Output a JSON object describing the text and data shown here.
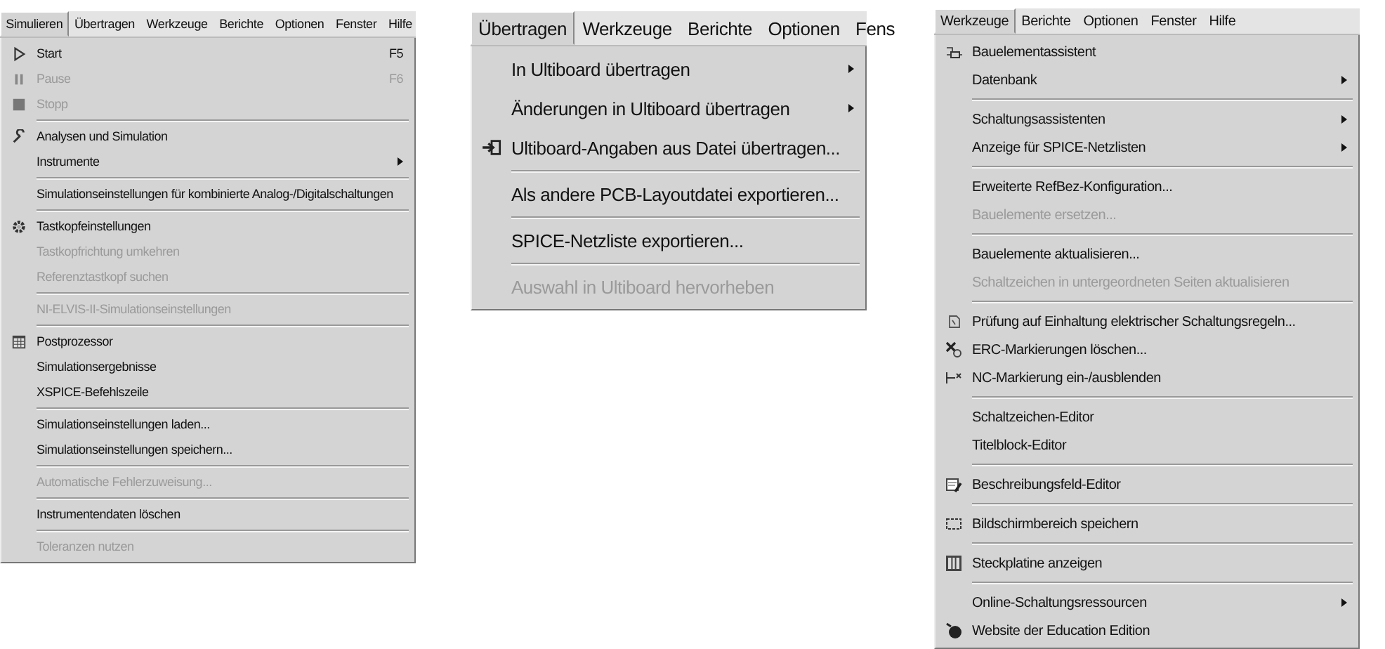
{
  "menus": [
    {
      "menubar": [
        {
          "label": "Simulieren",
          "selected": true
        },
        {
          "label": "Übertragen",
          "selected": false
        },
        {
          "label": "Werkzeuge",
          "selected": false
        },
        {
          "label": "Berichte",
          "selected": false
        },
        {
          "label": "Optionen",
          "selected": false
        },
        {
          "label": "Fenster",
          "selected": false
        },
        {
          "label": "Hilfe",
          "selected": false
        }
      ],
      "items": [
        {
          "kind": "item",
          "label": "Start",
          "shortcut": "F5",
          "disabled": false
        },
        {
          "kind": "item",
          "label": "Pause",
          "shortcut": "F6",
          "disabled": true
        },
        {
          "kind": "item",
          "label": "Stopp",
          "disabled": true
        },
        {
          "kind": "separator"
        },
        {
          "kind": "item",
          "label": "Analysen und Simulation",
          "disabled": false
        },
        {
          "kind": "item",
          "label": "Instrumente",
          "disabled": false,
          "submenu": true
        },
        {
          "kind": "separator"
        },
        {
          "kind": "item",
          "label": "Simulationseinstellungen für kombinierte Analog-/Digitalschaltungen",
          "disabled": false
        },
        {
          "kind": "separator"
        },
        {
          "kind": "item",
          "label": "Tastkopfeinstellungen",
          "disabled": false
        },
        {
          "kind": "item",
          "label": "Tastkopfrichtung umkehren",
          "disabled": true
        },
        {
          "kind": "item",
          "label": "Referenztastkopf suchen",
          "disabled": true
        },
        {
          "kind": "separator"
        },
        {
          "kind": "item",
          "label": "NI-ELVIS-II-Simulationseinstellungen",
          "disabled": true
        },
        {
          "kind": "separator"
        },
        {
          "kind": "item",
          "label": "Postprozessor",
          "disabled": false
        },
        {
          "kind": "item",
          "label": "Simulationsergebnisse",
          "disabled": false
        },
        {
          "kind": "item",
          "label": "XSPICE-Befehlszeile",
          "disabled": false
        },
        {
          "kind": "separator"
        },
        {
          "kind": "item",
          "label": "Simulationseinstellungen laden...",
          "disabled": false
        },
        {
          "kind": "item",
          "label": "Simulationseinstellungen speichern...",
          "disabled": false
        },
        {
          "kind": "separator"
        },
        {
          "kind": "item",
          "label": "Automatische Fehlerzuweisung...",
          "disabled": true
        },
        {
          "kind": "separator"
        },
        {
          "kind": "item",
          "label": "Instrumentendaten löschen",
          "disabled": false
        },
        {
          "kind": "separator"
        },
        {
          "kind": "item",
          "label": "Toleranzen nutzen",
          "disabled": true
        }
      ]
    },
    {
      "menubar": [
        {
          "label": "Übertragen",
          "selected": true
        },
        {
          "label": "Werkzeuge",
          "selected": false
        },
        {
          "label": "Berichte",
          "selected": false
        },
        {
          "label": "Optionen",
          "selected": false
        },
        {
          "label": "Fens",
          "selected": false
        }
      ],
      "items": [
        {
          "kind": "item",
          "label": "In Ultiboard übertragen",
          "disabled": false,
          "submenu": true
        },
        {
          "kind": "item",
          "label": "Änderungen in Ultiboard übertragen",
          "disabled": false,
          "submenu": true
        },
        {
          "kind": "item",
          "label": "Ultiboard-Angaben aus Datei übertragen...",
          "disabled": false
        },
        {
          "kind": "separator"
        },
        {
          "kind": "item",
          "label": "Als andere PCB-Layoutdatei exportieren...",
          "disabled": false
        },
        {
          "kind": "separator"
        },
        {
          "kind": "item",
          "label": "SPICE-Netzliste exportieren...",
          "disabled": false
        },
        {
          "kind": "separator"
        },
        {
          "kind": "item",
          "label": "Auswahl in Ultiboard hervorheben",
          "disabled": true
        }
      ]
    },
    {
      "menubar": [
        {
          "label": "Werkzeuge",
          "selected": true
        },
        {
          "label": "Berichte",
          "selected": false
        },
        {
          "label": "Optionen",
          "selected": false
        },
        {
          "label": "Fenster",
          "selected": false
        },
        {
          "label": "Hilfe",
          "selected": false
        }
      ],
      "items": [
        {
          "kind": "item",
          "label": "Bauelementassistent",
          "disabled": false
        },
        {
          "kind": "item",
          "label": "Datenbank",
          "disabled": false,
          "submenu": true
        },
        {
          "kind": "separator"
        },
        {
          "kind": "item",
          "label": "Schaltungsassistenten",
          "disabled": false,
          "submenu": true
        },
        {
          "kind": "item",
          "label": "Anzeige für SPICE-Netzlisten",
          "disabled": false,
          "submenu": true
        },
        {
          "kind": "separator"
        },
        {
          "kind": "item",
          "label": "Erweiterte RefBez-Konfiguration...",
          "disabled": false
        },
        {
          "kind": "item",
          "label": "Bauelemente ersetzen...",
          "disabled": true
        },
        {
          "kind": "separator"
        },
        {
          "kind": "item",
          "label": "Bauelemente aktualisieren...",
          "disabled": false
        },
        {
          "kind": "item",
          "label": "Schaltzeichen in untergeordneten Seiten aktualisieren",
          "disabled": true
        },
        {
          "kind": "separator"
        },
        {
          "kind": "item",
          "label": "Prüfung auf Einhaltung elektrischer Schaltungsregeln...",
          "disabled": false
        },
        {
          "kind": "item",
          "label": "ERC-Markierungen löschen...",
          "disabled": false
        },
        {
          "kind": "item",
          "label": "NC-Markierung ein-/ausblenden",
          "disabled": false
        },
        {
          "kind": "separator"
        },
        {
          "kind": "item",
          "label": "Schaltzeichen-Editor",
          "disabled": false
        },
        {
          "kind": "item",
          "label": "Titelblock-Editor",
          "disabled": false
        },
        {
          "kind": "separator"
        },
        {
          "kind": "item",
          "label": "Beschreibungsfeld-Editor",
          "disabled": false
        },
        {
          "kind": "separator"
        },
        {
          "kind": "item",
          "label": "Bildschirmbereich speichern",
          "disabled": false
        },
        {
          "kind": "separator"
        },
        {
          "kind": "item",
          "label": "Steckplatine anzeigen",
          "disabled": false
        },
        {
          "kind": "separator"
        },
        {
          "kind": "item",
          "label": "Online-Schaltungsressourcen",
          "disabled": false,
          "submenu": true
        },
        {
          "kind": "item",
          "label": "Website der Education Edition",
          "disabled": false
        }
      ]
    }
  ]
}
